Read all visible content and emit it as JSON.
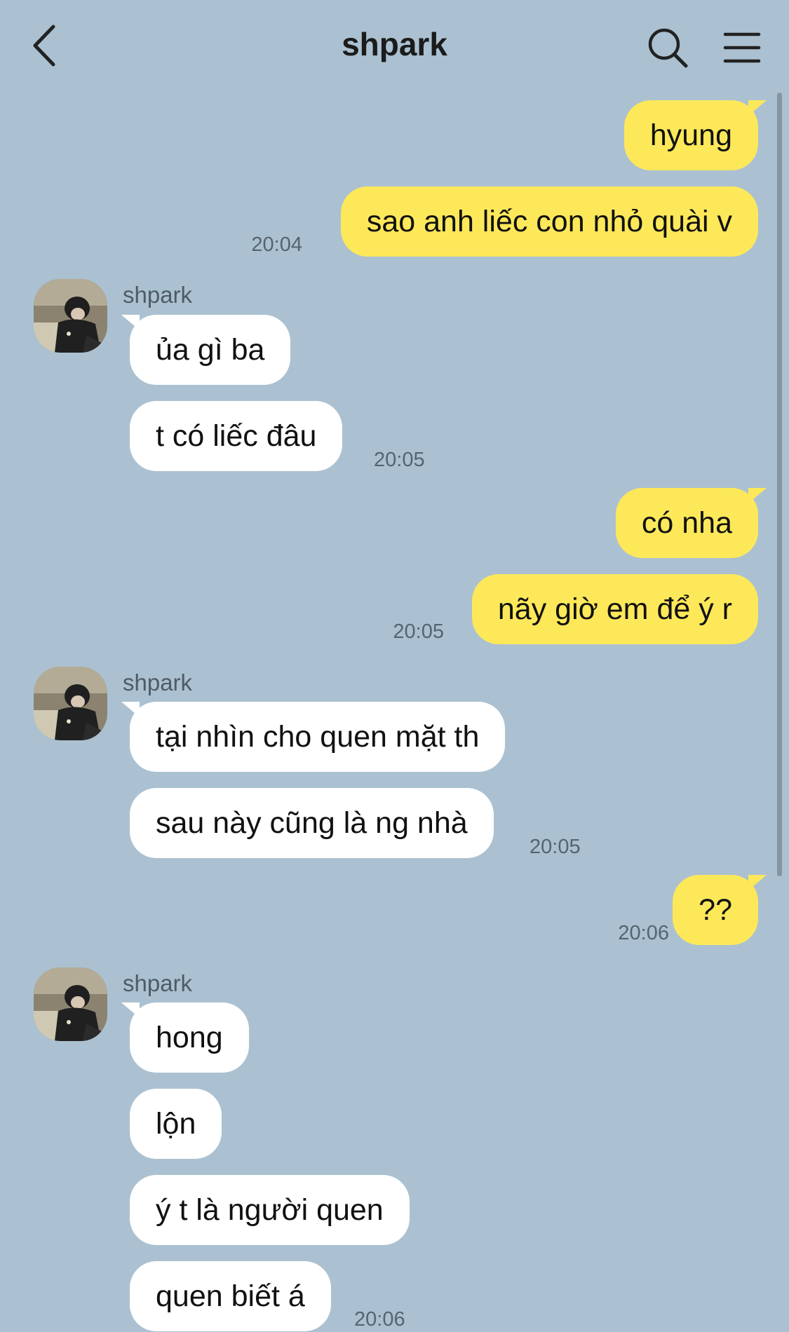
{
  "header": {
    "title": "shpark",
    "back_icon": "chevron-left-icon",
    "search_icon": "search-icon",
    "menu_icon": "hamburger-menu-icon"
  },
  "colors": {
    "background": "#abc1d1",
    "my_bubble": "#fde85a",
    "their_bubble": "#ffffff"
  },
  "messages": [
    {
      "from": "me",
      "text": "hyung"
    },
    {
      "from": "me",
      "text": "sao anh liếc con nhỏ quài v",
      "time": "20:04"
    },
    {
      "from": "shpark",
      "sender": "shpark",
      "text": "ủa gì ba"
    },
    {
      "from": "shpark",
      "text": "t có liếc đâu",
      "time": "20:05"
    },
    {
      "from": "me",
      "text": "có nha"
    },
    {
      "from": "me",
      "text": "nãy giờ em để ý r",
      "time": "20:05"
    },
    {
      "from": "shpark",
      "sender": "shpark",
      "text": "tại nhìn cho quen mặt th"
    },
    {
      "from": "shpark",
      "text": "sau này cũng là ng nhà",
      "time": "20:05"
    },
    {
      "from": "me",
      "text": "??",
      "time": "20:06"
    },
    {
      "from": "shpark",
      "sender": "shpark",
      "text": "hong"
    },
    {
      "from": "shpark",
      "text": "lộn"
    },
    {
      "from": "shpark",
      "text": "ý t là người quen"
    },
    {
      "from": "shpark",
      "text": "quen biết á",
      "time": "20:06"
    }
  ]
}
